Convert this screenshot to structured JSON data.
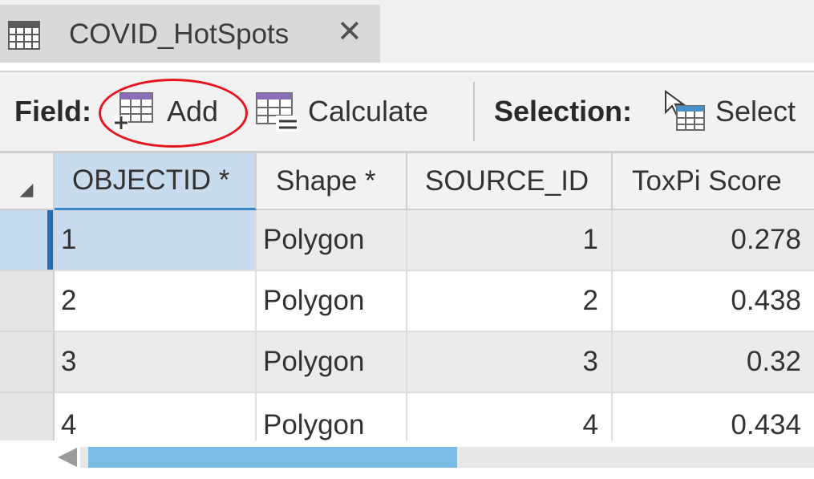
{
  "tab": {
    "title": "COVID_HotSpots",
    "close_glyph": "✕",
    "icon": "table-icon"
  },
  "toolbar": {
    "field_label": "Field:",
    "add_label": "Add",
    "add_icon": "add-field-icon",
    "calculate_label": "Calculate",
    "calculate_icon": "calculate-field-icon",
    "selection_label": "Selection:",
    "select_label": "Select",
    "select_icon": "select-by-attributes-icon",
    "highlight_color": "#e4151e"
  },
  "table": {
    "sort_indicator": "◢",
    "columns": [
      "OBJECTID *",
      "Shape *",
      "SOURCE_ID",
      "ToxPi Score"
    ],
    "rows": [
      {
        "objectid": "1",
        "shape": "Polygon",
        "source_id": "1",
        "toxpi": "0.278"
      },
      {
        "objectid": "2",
        "shape": "Polygon",
        "source_id": "2",
        "toxpi": "0.438"
      },
      {
        "objectid": "3",
        "shape": "Polygon",
        "source_id": "3",
        "toxpi": "0.32"
      },
      {
        "objectid": "4",
        "shape": "Polygon",
        "source_id": "4",
        "toxpi": "0.434"
      }
    ],
    "selected_row": 0,
    "selection_color": "#c9dcee"
  },
  "scrollbar": {
    "thumb_color": "#7bbde6",
    "position_fraction": 0.0
  }
}
